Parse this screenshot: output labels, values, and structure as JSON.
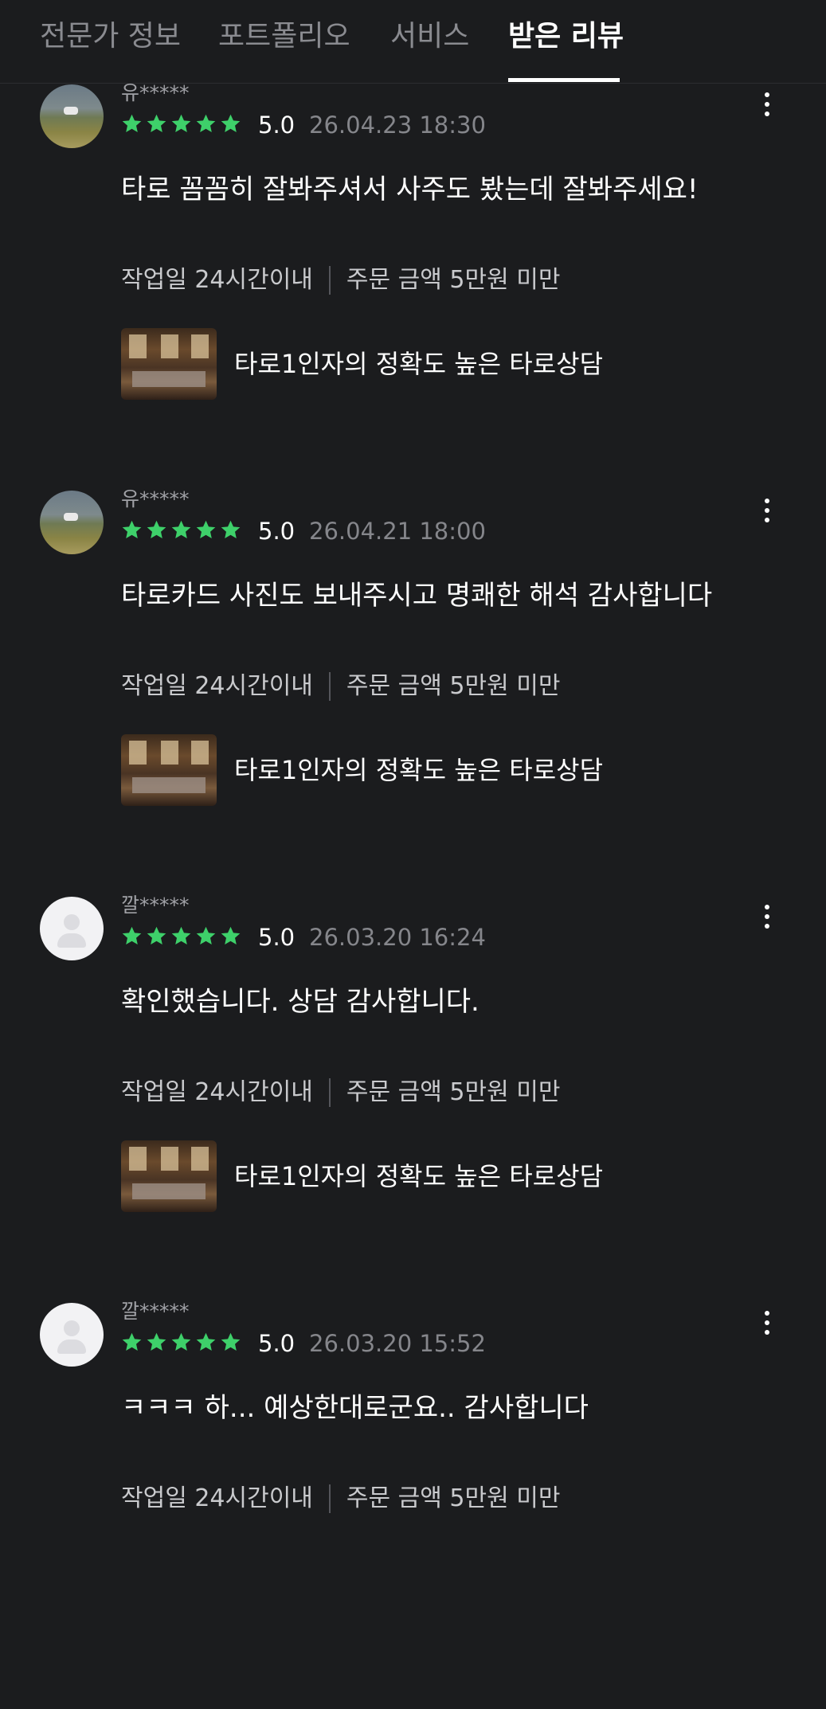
{
  "tabs": [
    {
      "label": "전문가 정보",
      "active": false
    },
    {
      "label": "포트폴리오",
      "active": false
    },
    {
      "label": "서비스",
      "active": false
    },
    {
      "label": "받은 리뷰",
      "active": true
    }
  ],
  "star_color": "#3ed06a",
  "reviews": [
    {
      "username": "유*****",
      "avatar": "photo",
      "rating": "5.0",
      "date": "26.04.23 18:30",
      "comment": "타로 꼼꼼히 잘봐주셔서 사주도 봤는데 잘봐주세요!",
      "work_days": "작업일 24시간이내",
      "order_amount": "주문 금액 5만원 미만",
      "service_title": "타로1인자의 정확도 높은 타로상담"
    },
    {
      "username": "유*****",
      "avatar": "photo",
      "rating": "5.0",
      "date": "26.04.21 18:00",
      "comment": "타로카드 사진도 보내주시고 명쾌한 해석 감사합니다",
      "work_days": "작업일 24시간이내",
      "order_amount": "주문 금액 5만원 미만",
      "service_title": "타로1인자의 정확도 높은 타로상담"
    },
    {
      "username": "깔*****",
      "avatar": "default",
      "rating": "5.0",
      "date": "26.03.20 16:24",
      "comment": "확인했습니다. 상담 감사합니다.",
      "work_days": "작업일 24시간이내",
      "order_amount": "주문 금액 5만원 미만",
      "service_title": "타로1인자의 정확도 높은 타로상담"
    },
    {
      "username": "깔*****",
      "avatar": "default",
      "rating": "5.0",
      "date": "26.03.20 15:52",
      "comment": "ㅋㅋㅋ 하... 예상한대로군요.. 감사합니다",
      "work_days": "작업일 24시간이내",
      "order_amount": "주문 금액 5만원 미만",
      "service_title": ""
    }
  ]
}
